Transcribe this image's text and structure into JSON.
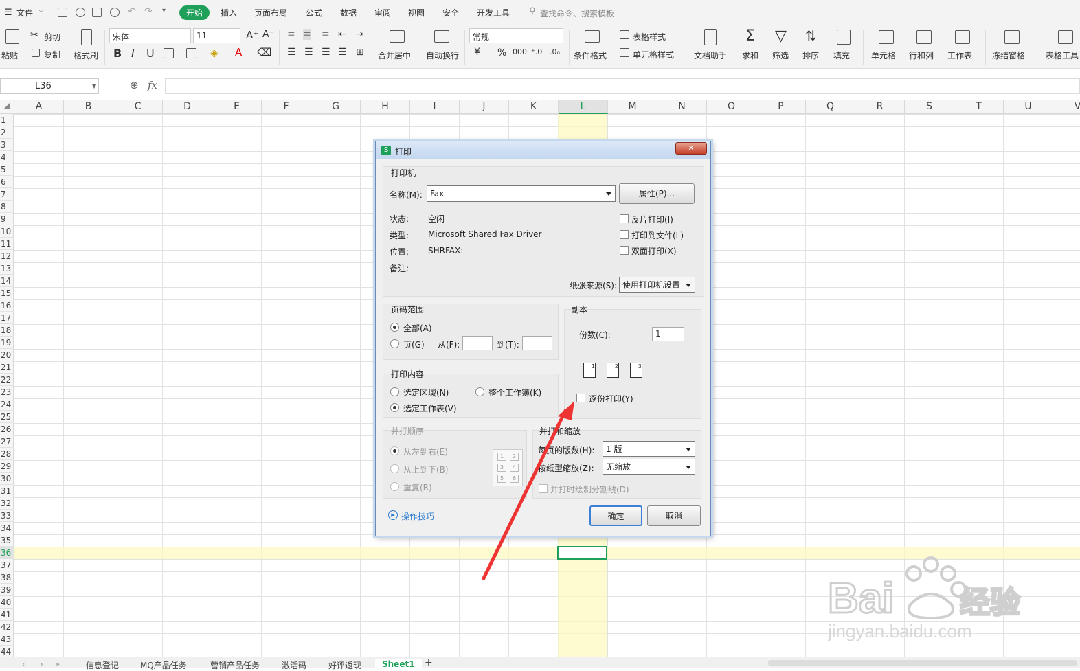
{
  "menubar": {
    "file": "文件",
    "tabs": [
      "开始",
      "插入",
      "页面布局",
      "公式",
      "数据",
      "审阅",
      "视图",
      "安全",
      "开发工具"
    ],
    "search_placeholder": "查找命令、搜索模板"
  },
  "toolbar": {
    "paste": "粘贴",
    "cut": "剪切",
    "copy": "复制",
    "format_painter": "格式刷",
    "font_name": "宋体",
    "font_size": "11",
    "merge_center": "合并居中",
    "wrap_text": "自动换行",
    "number_format": "常规",
    "conditional_format": "条件格式",
    "table_style": "表格样式",
    "cell_style": "单元格样式",
    "doc_assistant": "文档助手",
    "sum": "求和",
    "filter": "筛选",
    "sort": "排序",
    "fill": "填充",
    "cell": "单元格",
    "row_col": "行和列",
    "worksheet": "工作表",
    "freeze": "冻结窗格",
    "table_tools": "表格工具",
    "percent": "%",
    "thousands": "000"
  },
  "formula_bar": {
    "name_box": "L36",
    "fx": "fx",
    "content": ""
  },
  "grid": {
    "columns": [
      "A",
      "B",
      "C",
      "D",
      "E",
      "F",
      "G",
      "H",
      "I",
      "J",
      "K",
      "L",
      "M",
      "N",
      "O",
      "P",
      "Q",
      "R",
      "S",
      "T",
      "U",
      "V"
    ],
    "rows": [
      "1",
      "2",
      "3",
      "4",
      "5",
      "6",
      "7",
      "8",
      "9",
      "10",
      "11",
      "12",
      "13",
      "14",
      "15",
      "16",
      "17",
      "18",
      "19",
      "20",
      "21",
      "22",
      "23",
      "24",
      "25",
      "26",
      "27",
      "28",
      "29",
      "30",
      "31",
      "32",
      "33",
      "34",
      "35",
      "36",
      "37",
      "38",
      "39",
      "40",
      "41",
      "42",
      "43",
      "44"
    ],
    "active_cell": "L36",
    "highlight_color": "#fffbd5",
    "selection_color": "#1fa05a"
  },
  "sheets": {
    "tabs": [
      "信息登记",
      "MQ产品任务",
      "营销产品任务",
      "激活码",
      "好评返现",
      "Sheet1"
    ],
    "active": "Sheet1",
    "add": "+"
  },
  "dialog": {
    "title": "打印",
    "printer_group": "打印机",
    "name_label": "名称(M):",
    "printer_name": "Fax",
    "properties_button": "属性(P)...",
    "status_label": "状态:",
    "status_value": "空闲",
    "type_label": "类型:",
    "type_value": "Microsoft Shared Fax Driver",
    "location_label": "位置:",
    "location_value": "SHRFAX:",
    "comment_label": "备注:",
    "reverse_print": "反片打印(I)",
    "print_to_file": "打印到文件(L)",
    "duplex": "双面打印(X)",
    "paper_source_label": "纸张来源(S):",
    "paper_source_value": "使用打印机设置",
    "page_range_group": "页码范围",
    "all_pages": "全部(A)",
    "pages": "页(G)",
    "from_label": "从(F):",
    "to_label": "到(T):",
    "copies_group": "副本",
    "copies_label": "份数(C):",
    "copies_value": "1",
    "collate": "逐份打印(Y)",
    "print_content_group": "打印内容",
    "selection": "选定区域(N)",
    "whole_workbook": "整个工作簿(K)",
    "selected_sheet": "选定工作表(V)",
    "order_group": "并打顺序",
    "left_to_right": "从左到右(E)",
    "top_to_bottom": "从上到下(B)",
    "repeat": "重复(R)",
    "zoom_group": "并打和缩放",
    "pages_per_sheet_label": "每页的版数(H):",
    "pages_per_sheet_value": "1 版",
    "scale_label": "按纸型缩放(Z):",
    "scale_value": "无缩放",
    "draw_borders": "并打时绘制分割线(D)",
    "tips_link": "操作技巧",
    "ok": "确定",
    "cancel": "取消",
    "order_numbers": [
      "1",
      "2",
      "3",
      "4",
      "5",
      "6"
    ]
  }
}
